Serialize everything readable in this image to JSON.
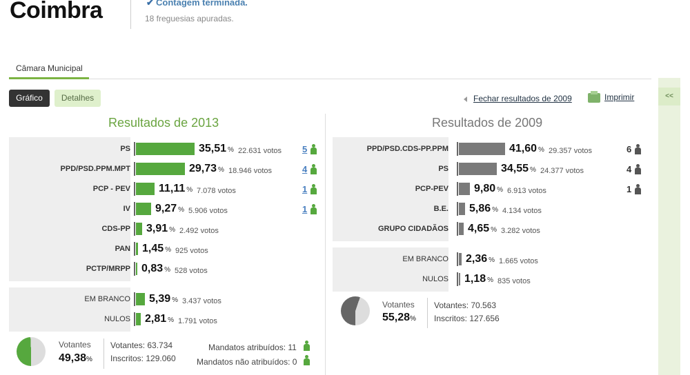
{
  "header": {
    "title": "Coimbra",
    "status": "Contagem terminada.",
    "subtitle": "18 freguesias apuradas.",
    "check_icon": "check-icon"
  },
  "tabs": [
    {
      "label": "Câmara Municipal",
      "active": true
    }
  ],
  "buttons": {
    "grafico": "Gráfico",
    "detalhes": "Detalhes",
    "close_2009": "Fechar resultados de 2009",
    "print": "Imprimir",
    "sidebar_toggle": "<<"
  },
  "colors": {
    "accent": "#56a83e",
    "gray_bar": "#7a7a7a",
    "link": "#4a80c0"
  },
  "results_2013": {
    "title": "Resultados de 2013",
    "parties": [
      {
        "name": "PS",
        "pct": "35,51",
        "votos": "22.631 votos",
        "seats": "5",
        "value": 35.51
      },
      {
        "name": "PPD/PSD.PPM.MPT",
        "pct": "29,73",
        "votos": "18.946 votos",
        "seats": "4",
        "value": 29.73
      },
      {
        "name": "PCP - PEV",
        "pct": "11,11",
        "votos": "7.078 votos",
        "seats": "1",
        "value": 11.11
      },
      {
        "name": "IV",
        "pct": "9,27",
        "votos": "5.906 votos",
        "seats": "1",
        "value": 9.27
      },
      {
        "name": "CDS-PP",
        "pct": "3,91",
        "votos": "2.492 votos",
        "seats": "",
        "value": 3.91
      },
      {
        "name": "PAN",
        "pct": "1,45",
        "votos": "925 votos",
        "seats": "",
        "value": 1.45
      },
      {
        "name": "PCTP/MRPP",
        "pct": "0,83",
        "votos": "528 votos",
        "seats": "",
        "value": 0.83
      }
    ],
    "others": [
      {
        "name": "EM BRANCO",
        "pct": "5,39",
        "votos": "3.437 votos",
        "value": 5.39
      },
      {
        "name": "NULOS",
        "pct": "2,81",
        "votos": "1.791 votos",
        "value": 2.81
      }
    ],
    "summary": {
      "votantes_label": "Votantes",
      "votantes_pct": "49,38",
      "pct_symbol": "%",
      "votantes_line": "Votantes: 63.734",
      "inscritos_line": "Inscritos: 129.060",
      "mandatos_atribuidos": "Mandatos atribuídos: 11",
      "mandatos_nao_atribuidos": "Mandatos não atribuídos: 0",
      "turnout_value": 49.38
    }
  },
  "results_2009": {
    "title": "Resultados de 2009",
    "parties": [
      {
        "name": "PPD/PSD.CDS-PP.PPM",
        "pct": "41,60",
        "votos": "29.357 votos",
        "seats": "6",
        "value": 41.6
      },
      {
        "name": "PS",
        "pct": "34,55",
        "votos": "24.377 votos",
        "seats": "4",
        "value": 34.55
      },
      {
        "name": "PCP-PEV",
        "pct": "9,80",
        "votos": "6.913 votos",
        "seats": "1",
        "value": 9.8
      },
      {
        "name": "B.E.",
        "pct": "5,86",
        "votos": "4.134 votos",
        "seats": "",
        "value": 5.86
      },
      {
        "name": "GRUPO CIDADÃOS",
        "pct": "4,65",
        "votos": "3.282 votos",
        "seats": "",
        "value": 4.65
      }
    ],
    "others": [
      {
        "name": "EM BRANCO",
        "pct": "2,36",
        "votos": "1.665 votos",
        "value": 2.36
      },
      {
        "name": "NULOS",
        "pct": "1,18",
        "votos": "835 votos",
        "value": 1.18
      }
    ],
    "summary": {
      "votantes_label": "Votantes",
      "votantes_pct": "55,28",
      "pct_symbol": "%",
      "votantes_line": "Votantes: 70.563",
      "inscritos_line": "Inscritos: 127.656",
      "turnout_value": 55.28
    }
  },
  "pct_symbol": "%"
}
